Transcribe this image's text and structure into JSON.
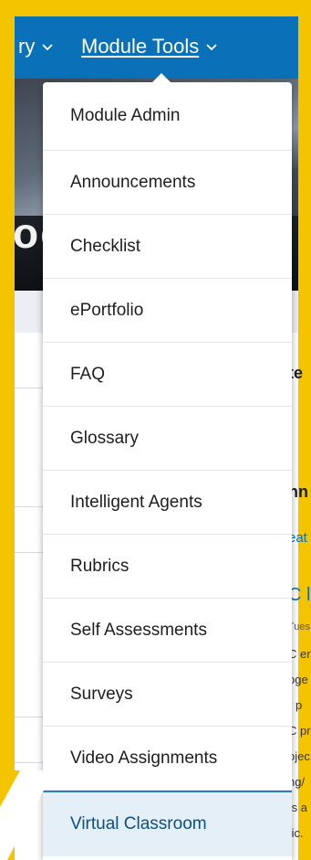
{
  "nav": {
    "items": [
      {
        "label": "ry"
      },
      {
        "label": "Module Tools"
      }
    ]
  },
  "banner": {
    "letters": "oc"
  },
  "menu": {
    "items": [
      {
        "label": "Module Admin"
      },
      {
        "label": "Announcements"
      },
      {
        "label": "Checklist"
      },
      {
        "label": "ePortfolio"
      },
      {
        "label": "FAQ"
      },
      {
        "label": "Glossary"
      },
      {
        "label": "Intelligent Agents"
      },
      {
        "label": "Rubrics"
      },
      {
        "label": "Self Assessments"
      },
      {
        "label": "Surveys"
      },
      {
        "label": "Video Assignments"
      },
      {
        "label": "Virtual Classroom"
      }
    ]
  },
  "background": {
    "right_fragments": [
      "te",
      "nn",
      "eat",
      "C l",
      "Tues",
      "C er",
      "oge",
      "r p",
      "C pr",
      "ojec",
      "ng/",
      "ts a",
      "tic."
    ]
  },
  "colors": {
    "frame": "#f4c400",
    "nav": "#0a70b7",
    "link": "#0a70b7",
    "active_item_bg": "#e4eff8"
  },
  "icons": {
    "chevron": "chevron-down-icon"
  }
}
